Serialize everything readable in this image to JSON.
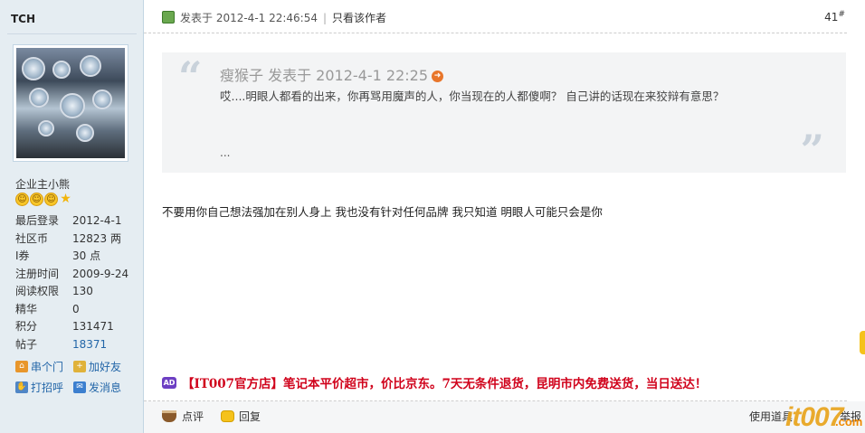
{
  "author": {
    "name": "TCH",
    "group": "企业主小熊",
    "stars_icon": "smiley-star-rank",
    "stats": [
      {
        "label": "最后登录",
        "value": "2012-4-1",
        "link": false
      },
      {
        "label": "社区币",
        "value": "12823 两",
        "link": false
      },
      {
        "label": "I券",
        "value": "30 点",
        "link": false
      },
      {
        "label": "注册时间",
        "value": "2009-9-24",
        "link": false
      },
      {
        "label": "阅读权限",
        "value": "130",
        "link": false
      },
      {
        "label": "精华",
        "value": "0",
        "link": false
      },
      {
        "label": "积分",
        "value": "131471",
        "link": false
      },
      {
        "label": "帖子",
        "value": "18371",
        "link": true
      }
    ],
    "actions": {
      "visit": "串个门",
      "add_friend": "加好友",
      "greet": "打招呼",
      "message": "发消息"
    }
  },
  "post": {
    "posted_at": "发表于 2012-4-1 22:46:54",
    "author_only": "只看该作者",
    "floor": "41",
    "floor_mark": "#",
    "quote": {
      "head": "瘦猴子 发表于 2012-4-1 22:25",
      "text": "哎....明眼人都看的出来，你再骂用魔声的人，你当现在的人都傻啊？   自己讲的话现在来狡辩有意思？",
      "ellipsis": "..."
    },
    "body": "不要用你自己想法强加在别人身上 我也没有针对任何品牌 我只知道 明眼人可能只会是你",
    "ad": {
      "badge": "AD",
      "text": "【IT007官方店】笔记本平价超市，价比京东。7天无条件退货，昆明市内免费送货，当日送达！"
    },
    "footer": {
      "comment": "点评",
      "reply": "回复",
      "tools": "使用道具",
      "report": "举报"
    },
    "logo": {
      "main": "it007",
      "suffix": ".com"
    }
  },
  "colors": {
    "sidebar_bg": "#e5edf2",
    "link": "#2366a8",
    "ad_red": "#d0021b",
    "quote_bg": "#f3f4f5"
  }
}
